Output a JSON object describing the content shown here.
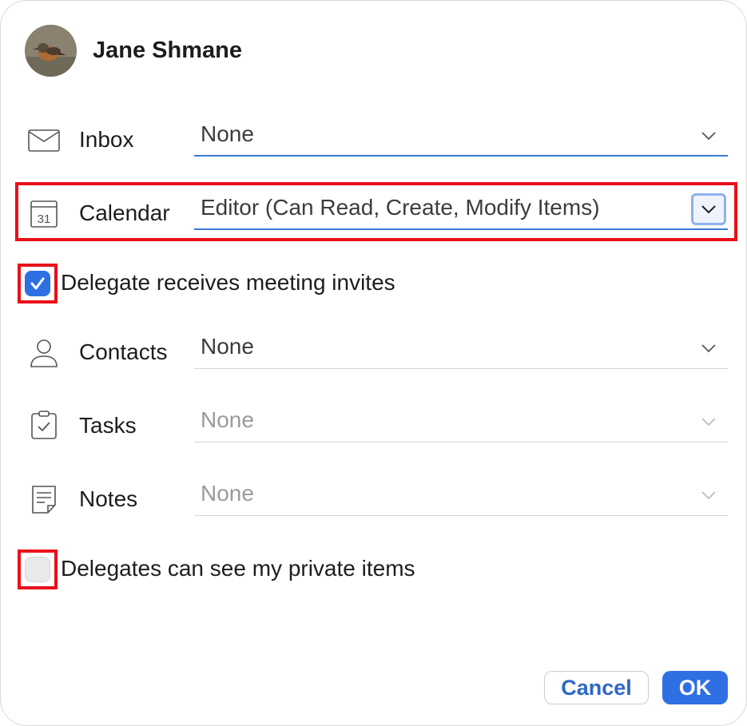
{
  "user": {
    "name": "Jane Shmane"
  },
  "rows": {
    "inbox": {
      "label": "Inbox",
      "value": "None"
    },
    "calendar": {
      "label": "Calendar",
      "value": "Editor (Can Read, Create, Modify Items)",
      "icon_text": "31"
    },
    "contacts": {
      "label": "Contacts",
      "value": "None"
    },
    "tasks": {
      "label": "Tasks",
      "value": "None"
    },
    "notes": {
      "label": "Notes",
      "value": "None"
    }
  },
  "checkboxes": {
    "meeting_invites": {
      "label": "Delegate receives meeting invites",
      "checked": true
    },
    "private_items": {
      "label": "Delegates can see my private items",
      "checked": false
    }
  },
  "buttons": {
    "cancel": "Cancel",
    "ok": "OK"
  },
  "colors": {
    "accent": "#2f6fe4",
    "highlight": "#e8101a"
  }
}
